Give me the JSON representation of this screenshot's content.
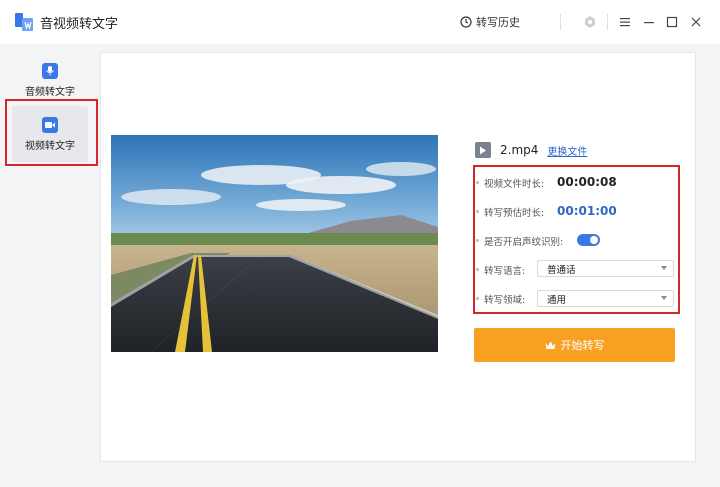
{
  "app": {
    "title": "音视频转文字",
    "history_label": "转写历史"
  },
  "sidebar": {
    "items": [
      {
        "label": "音频转文字",
        "icon": "microphone-icon"
      },
      {
        "label": "视频转文字",
        "icon": "video-camera-icon"
      }
    ]
  },
  "file": {
    "name": "2.mp4",
    "change_label": "更换文件"
  },
  "info": {
    "duration_label": "视频文件时长:",
    "duration_value": "00:00:08",
    "estimate_label": "转写预估时长:",
    "estimate_value": "00:01:00",
    "voiceprint_label": "是否开启声纹识别:",
    "voiceprint_enabled": true,
    "language_label": "转写语言:",
    "language_value": "普通话",
    "domain_label": "转写领域:",
    "domain_value": "通用"
  },
  "actions": {
    "start_label": "开始转写"
  },
  "colors": {
    "accent": "#3b78e7",
    "start_button": "#f7a021",
    "highlight": "#d6262c",
    "link": "#2d66c9"
  }
}
